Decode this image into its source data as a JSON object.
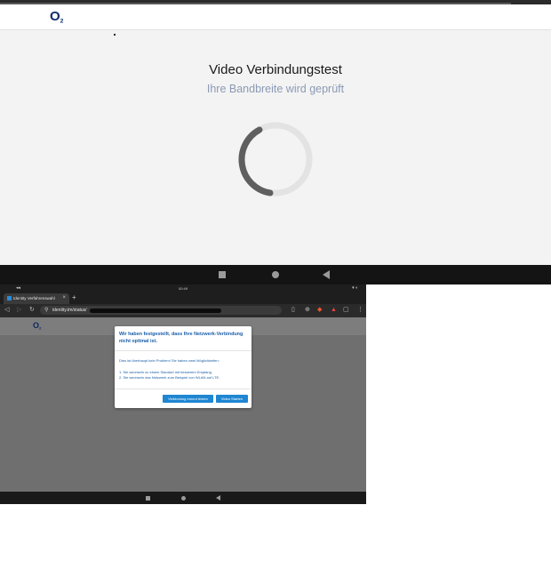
{
  "top": {
    "logo": "O",
    "logo_sub": "2",
    "title": "Video Verbindungstest",
    "subtitle": "Ihre Bandbreite wird geprüft",
    "spinner_icon": "loading-spinner-icon"
  },
  "tablet": {
    "status_time": "00:49",
    "status_left": "◂◂",
    "status_right": "▾ ◐",
    "tab_title": "Identity Verfahrenswahl",
    "tab_close": "×",
    "new_tab": "+",
    "url": "identity.tm/status/",
    "logo": "O",
    "logo_sub": "2",
    "dialog": {
      "title": "Wir haben festgestellt, dass Ihre Netzwerk-Verbindung nicht optimal ist.",
      "intro": "Dies ist überhaupt kein Problem! Sie haben zwei Möglichkeiten:",
      "option1": "1. Sie wechseln zu einem Standort mit besserem Empfang.",
      "option2": "2. Sie wechseln das Netzwerk zum Beispiel von WLAN auf LTE.",
      "retry_label": "Verbindung erneut testen",
      "start_label": "Video Starten"
    }
  },
  "colors": {
    "brand_blue": "#0a2a6b",
    "dialog_blue": "#1b5ea8",
    "button_blue": "#1f86d2",
    "subtitle": "#8b9ab5"
  }
}
